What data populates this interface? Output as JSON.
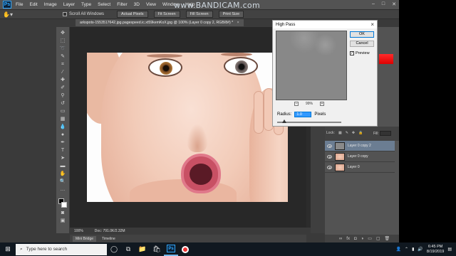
{
  "app": {
    "logo": "Ps",
    "menu": [
      "File",
      "Edit",
      "Image",
      "Layer",
      "Type",
      "Select",
      "Filter",
      "3D",
      "View",
      "Window",
      "Help"
    ],
    "window_controls": [
      "–",
      "□",
      "✕"
    ]
  },
  "watermark": "www.BANDICAM.com",
  "options_bar": {
    "tool_icon": "hand-icon",
    "scroll_all_label": "Scroll All Windows",
    "buttons": [
      "Actual Pixels",
      "Fit Screen",
      "Fill Screen",
      "Print Size"
    ]
  },
  "document": {
    "tab_title": "arkspots-1553517642.jpg.pagespeed.ic.xt59kemKoX.jpg @ 100% (Layer 0 copy 2, RGB/8#) *",
    "zoom": "100%",
    "doc_info": "Doc: 791.0K/2.32M"
  },
  "bottom_tabs": [
    "Mini Bridge",
    "Timeline"
  ],
  "dialog": {
    "title": "High Pass",
    "ok_label": "OK",
    "cancel_label": "Cancel",
    "preview_label": "Preview",
    "preview_checked": true,
    "zoom_label": "99%",
    "radius_label": "Radius:",
    "radius_value": "1.0",
    "radius_unit": "Pixels"
  },
  "layers_panel": {
    "lock_label": "Lock:",
    "fill_label": "Fill:",
    "layers": [
      {
        "name": "Layer 0 copy 2",
        "selected": true,
        "thumb": "high-pass"
      },
      {
        "name": "Layer 0 copy",
        "selected": false,
        "thumb": "photo"
      },
      {
        "name": "Layer 0",
        "selected": false,
        "thumb": "photo"
      }
    ]
  },
  "taskbar": {
    "search_placeholder": "Type here to search",
    "time": "6:45 PM",
    "date": "8/19/2019"
  },
  "colors": {
    "accent": "#31a8ff",
    "selected_layer": "#6b7d92",
    "foreground": "#000000",
    "background": "#ffffff"
  }
}
